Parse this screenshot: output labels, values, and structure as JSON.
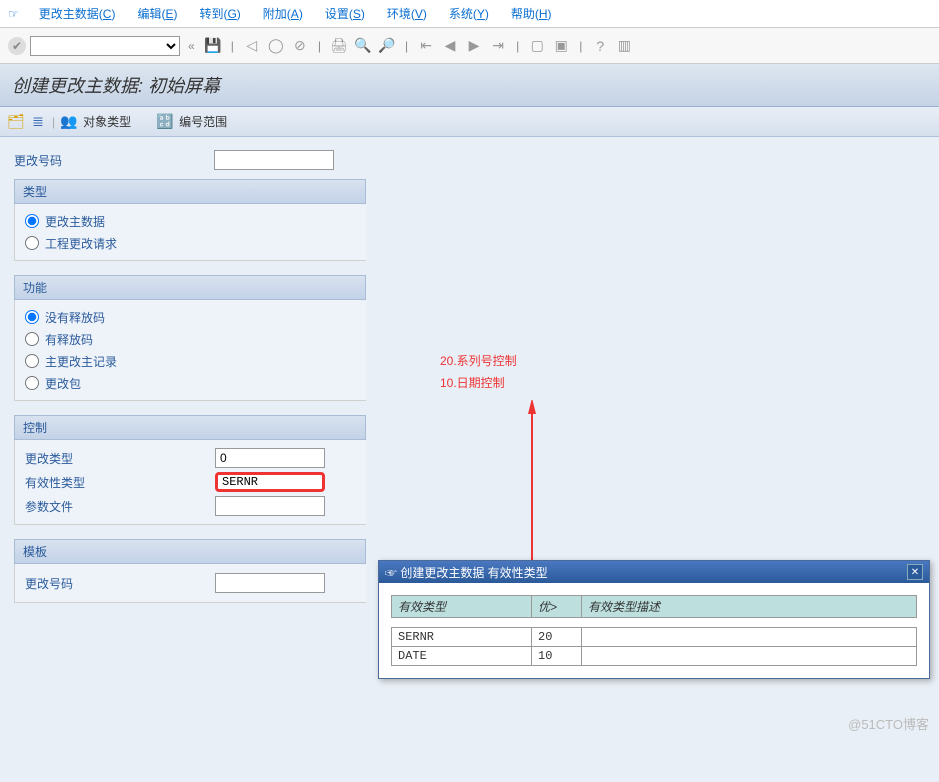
{
  "menubar": {
    "items": [
      {
        "label": "更改主数据(",
        "key": "C",
        "tail": ")"
      },
      {
        "label": "编辑(",
        "key": "E",
        "tail": ")"
      },
      {
        "label": "转到(",
        "key": "G",
        "tail": ")"
      },
      {
        "label": "附加(",
        "key": "A",
        "tail": ")"
      },
      {
        "label": "设置(",
        "key": "S",
        "tail": ")"
      },
      {
        "label": "环境(",
        "key": "V",
        "tail": ")"
      },
      {
        "label": "系统(",
        "key": "Y",
        "tail": ")"
      },
      {
        "label": "帮助(",
        "key": "H",
        "tail": ")"
      }
    ]
  },
  "title": "创建更改主数据: 初始屏幕",
  "app_toolbar": {
    "object_type": "对象类型",
    "number_range": "编号范围"
  },
  "fields": {
    "change_number_label": "更改号码",
    "change_number_value": ""
  },
  "group_type": {
    "title": "类型",
    "options": [
      "更改主数据",
      "工程更改请求"
    ],
    "selected": 0
  },
  "group_function": {
    "title": "功能",
    "options": [
      "没有释放码",
      "有释放码",
      "主更改主记录",
      "更改包"
    ],
    "selected": 0
  },
  "group_control": {
    "title": "控制",
    "rows": [
      {
        "label": "更改类型",
        "value": "0"
      },
      {
        "label": "有效性类型",
        "value": "SERNR",
        "highlight": true
      },
      {
        "label": "参数文件",
        "value": ""
      }
    ]
  },
  "group_template": {
    "title": "模板",
    "change_number_label": "更改号码",
    "change_number_value": ""
  },
  "annotation": {
    "line1": "20.系列号控制",
    "line2": "10.日期控制"
  },
  "popup": {
    "title": "创建更改主数据 有效性类型",
    "columns": [
      "有效类型",
      "优>",
      "有效类型描述"
    ],
    "rows": [
      {
        "c1": "SERNR",
        "c2": "20",
        "c3": ""
      },
      {
        "c1": "DATE",
        "c2": "10",
        "c3": ""
      }
    ]
  },
  "watermark": "@51CTO博客"
}
